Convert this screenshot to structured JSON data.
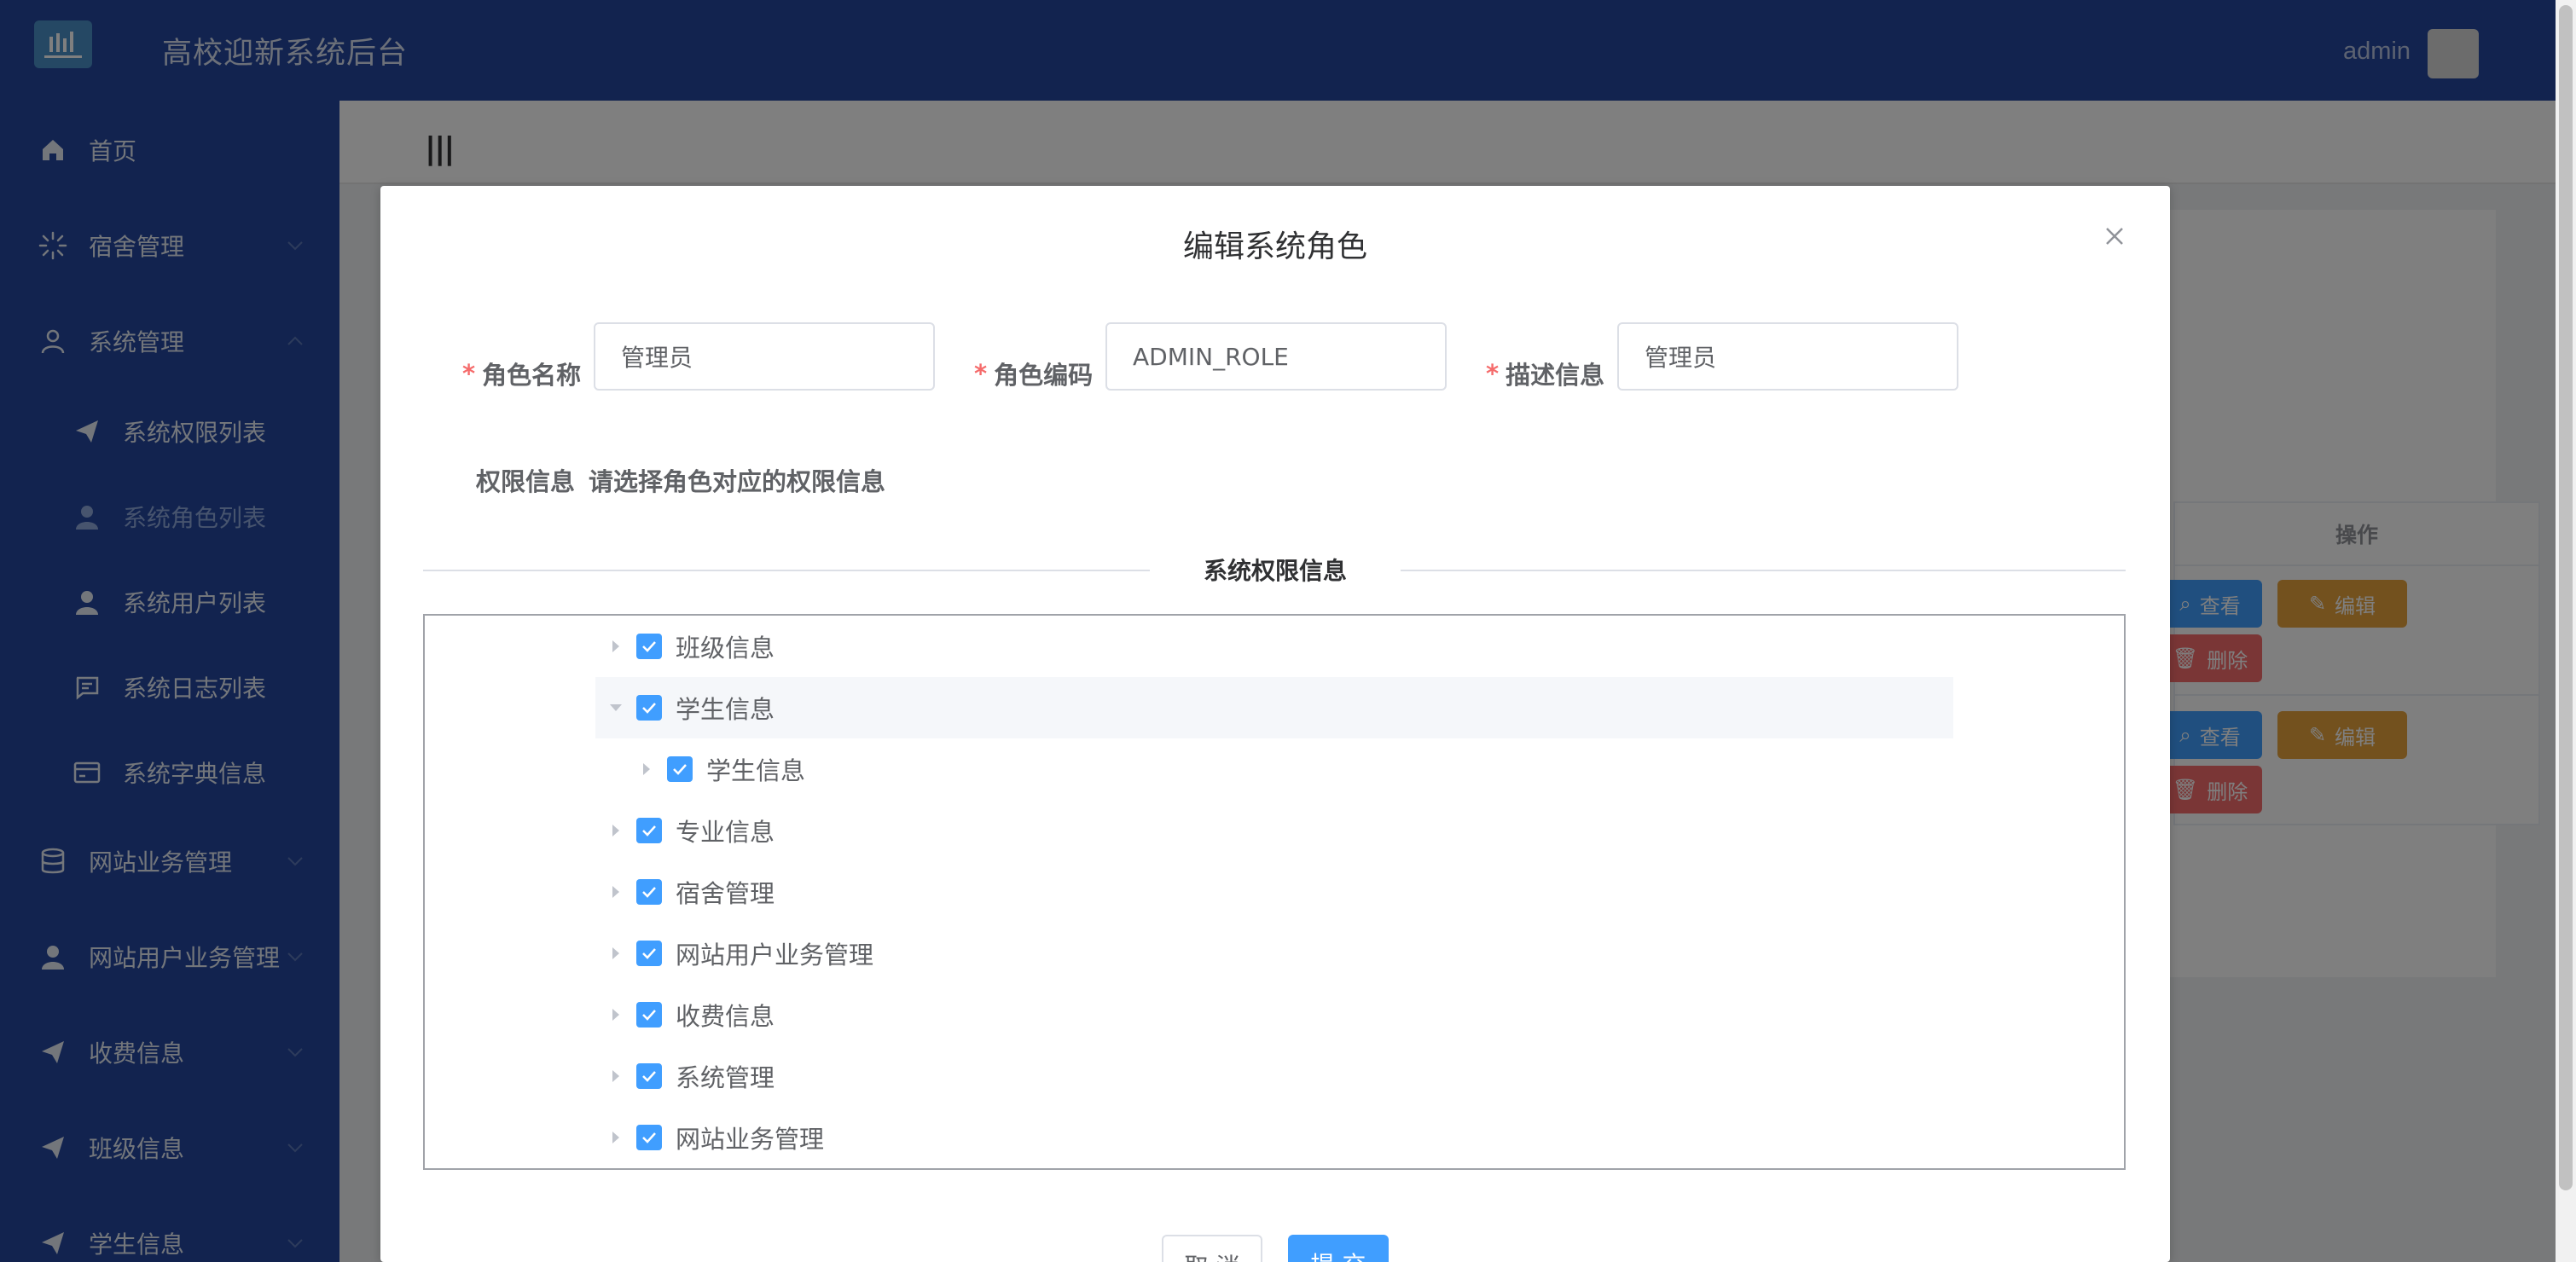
{
  "app": {
    "title": "高校迎新系统后台",
    "user": "admin"
  },
  "sidebar": {
    "items": [
      {
        "label": "首页",
        "icon": "home-icon"
      },
      {
        "label": "宿舍管理",
        "icon": "loading-icon"
      },
      {
        "label": "系统管理",
        "icon": "user-icon"
      },
      {
        "label": "系统权限列表",
        "icon": "send-icon"
      },
      {
        "label": "系统角色列表",
        "icon": "user-solid-icon",
        "active": true
      },
      {
        "label": "系统用户列表",
        "icon": "user-solid-icon"
      },
      {
        "label": "系统日志列表",
        "icon": "message-icon"
      },
      {
        "label": "系统字典信息",
        "icon": "card-icon"
      },
      {
        "label": "网站业务管理",
        "icon": "database-icon"
      },
      {
        "label": "网站用户业务管理",
        "icon": "user-solid-icon"
      },
      {
        "label": "收费信息",
        "icon": "send-icon"
      },
      {
        "label": "班级信息",
        "icon": "send-icon"
      },
      {
        "label": "学生信息",
        "icon": "send-icon"
      }
    ]
  },
  "topbar": {
    "menu_toggle": "|||"
  },
  "background_table": {
    "header": "操作",
    "view_label": "查看",
    "edit_label": "编辑",
    "delete_label": "删除"
  },
  "dialog": {
    "title": "编辑系统角色",
    "fields": {
      "role_name_label": "角色名称",
      "role_name_value": "管理员",
      "role_code_label": "角色编码",
      "role_code_value": "ADMIN_ROLE",
      "desc_label": "描述信息",
      "desc_value": "管理员"
    },
    "permission_label": "权限信息",
    "permission_hint": "请选择角色对应的权限信息",
    "divider_text": "系统权限信息",
    "tree": [
      {
        "label": "班级信息",
        "level": 0,
        "expanded": false,
        "checked": true
      },
      {
        "label": "学生信息",
        "level": 0,
        "expanded": true,
        "checked": true
      },
      {
        "label": "学生信息",
        "level": 1,
        "expanded": false,
        "checked": true
      },
      {
        "label": "专业信息",
        "level": 0,
        "expanded": false,
        "checked": true
      },
      {
        "label": "宿舍管理",
        "level": 0,
        "expanded": false,
        "checked": true
      },
      {
        "label": "网站用户业务管理",
        "level": 0,
        "expanded": false,
        "checked": true
      },
      {
        "label": "收费信息",
        "level": 0,
        "expanded": false,
        "checked": true
      },
      {
        "label": "系统管理",
        "level": 0,
        "expanded": false,
        "checked": true
      },
      {
        "label": "网站业务管理",
        "level": 0,
        "expanded": false,
        "checked": true
      }
    ],
    "cancel_label": "取 消",
    "submit_label": "提 交"
  },
  "colors": {
    "sidebar_bg": "#24479e",
    "primary": "#409eff",
    "warning": "#e6a23c",
    "danger": "#f56c6c",
    "required": "#f56c6c"
  }
}
